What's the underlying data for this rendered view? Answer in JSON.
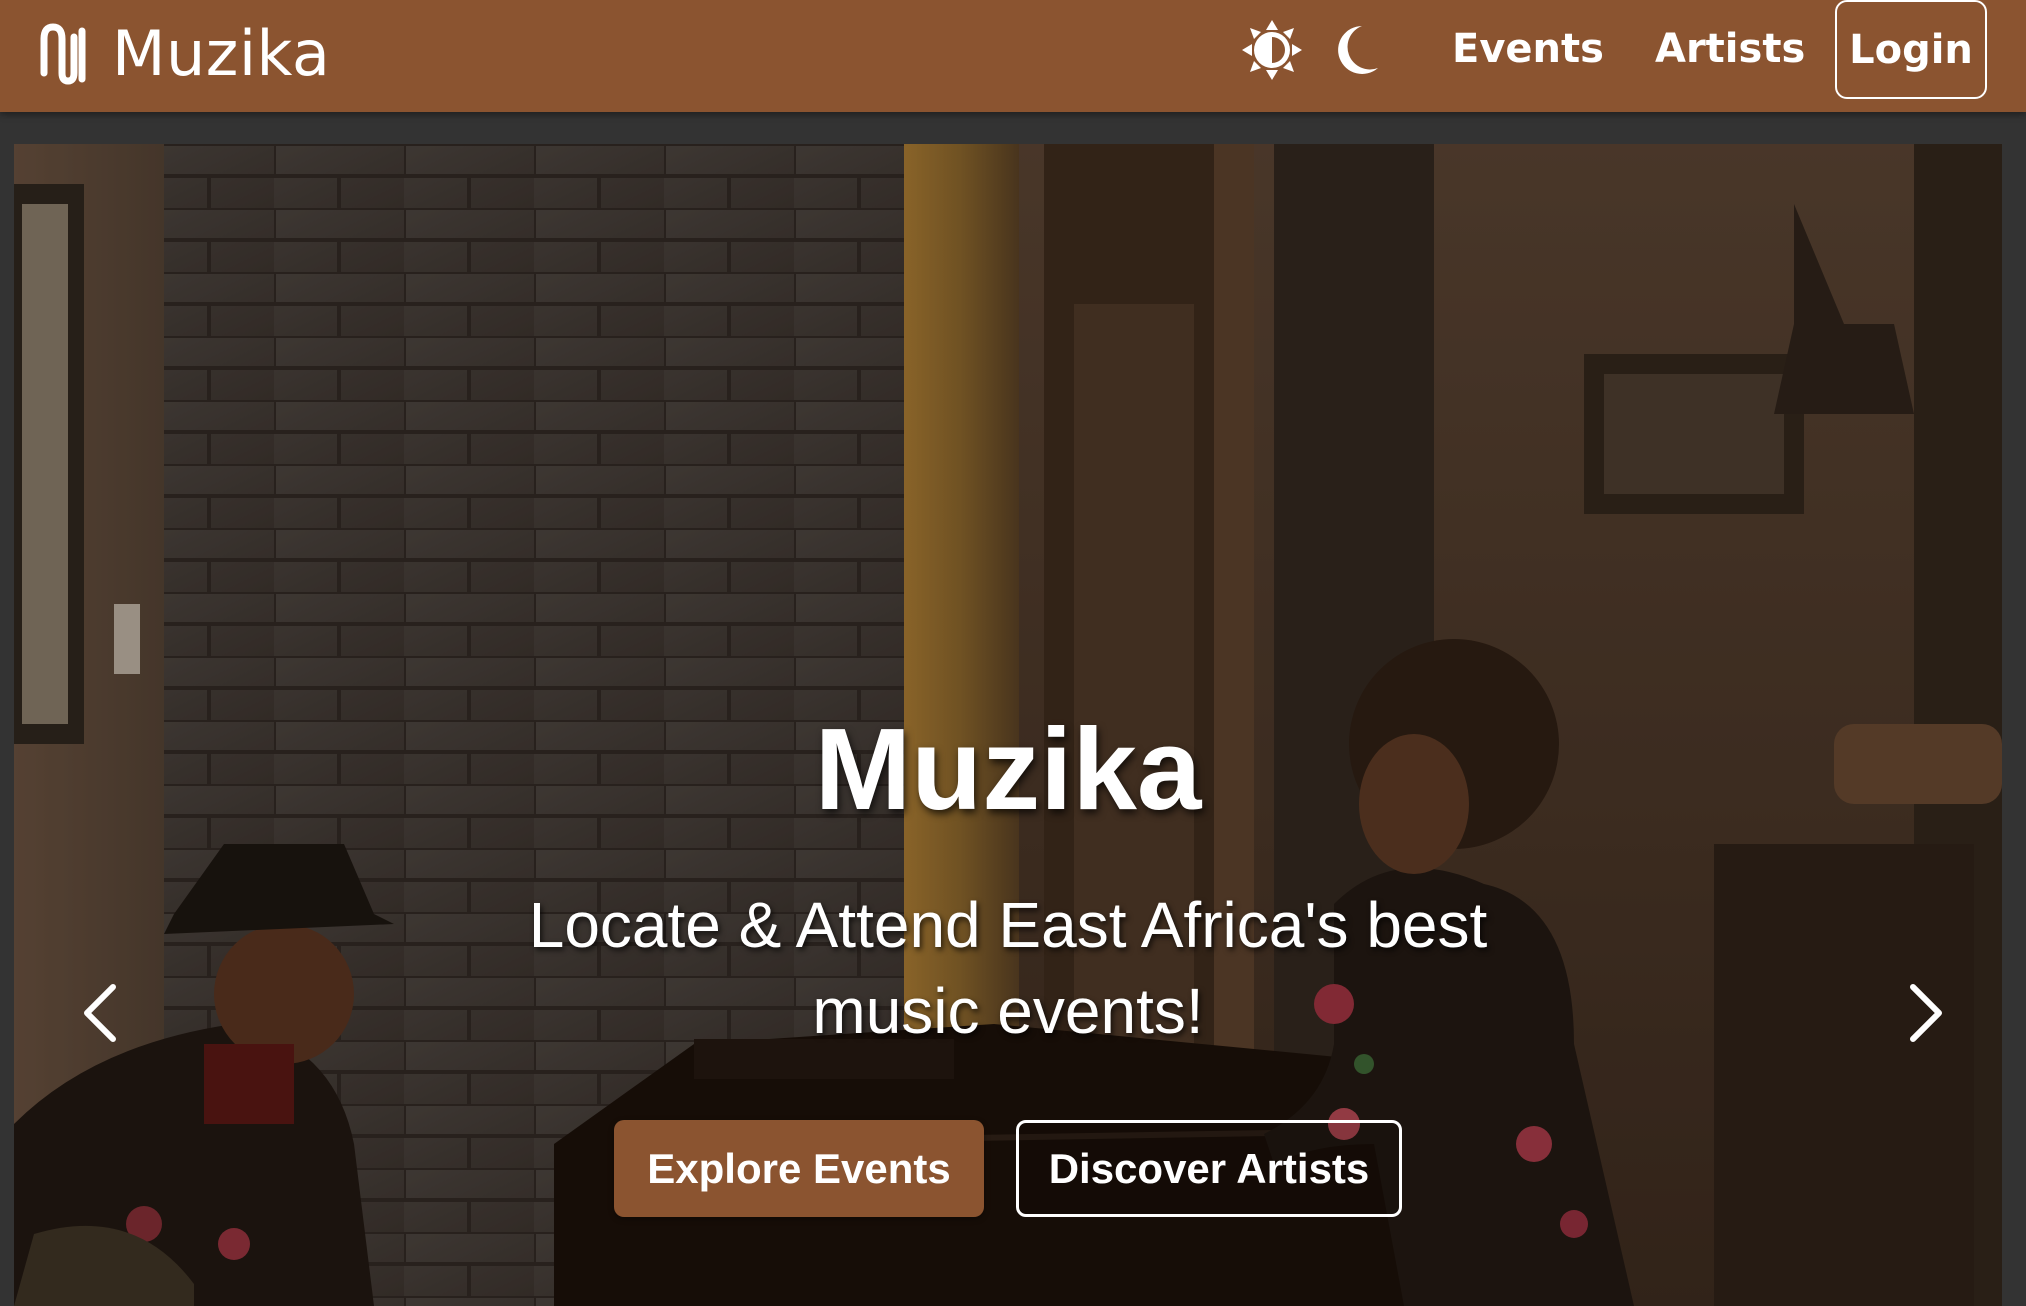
{
  "navbar": {
    "brand_name": "Muzika",
    "brand_icon": "muzika-logo-icon",
    "theme_light_icon": "half-sun-icon",
    "theme_dark_icon": "crescent-moon-icon",
    "links": {
      "events": "Events",
      "artists": "Artists"
    },
    "login_label": "Login"
  },
  "hero": {
    "title": "Muzika",
    "subtitle": "Locate & Attend East Africa's best music events!",
    "primary_cta": "Explore Events",
    "secondary_cta": "Discover Artists",
    "prev_icon": "chevron-left-icon",
    "next_icon": "chevron-right-icon",
    "background_image": "pianist-and-singer-photo"
  },
  "colors": {
    "brand_brown": "#8b5430",
    "page_background": "#333333",
    "text_white": "#ffffff"
  }
}
